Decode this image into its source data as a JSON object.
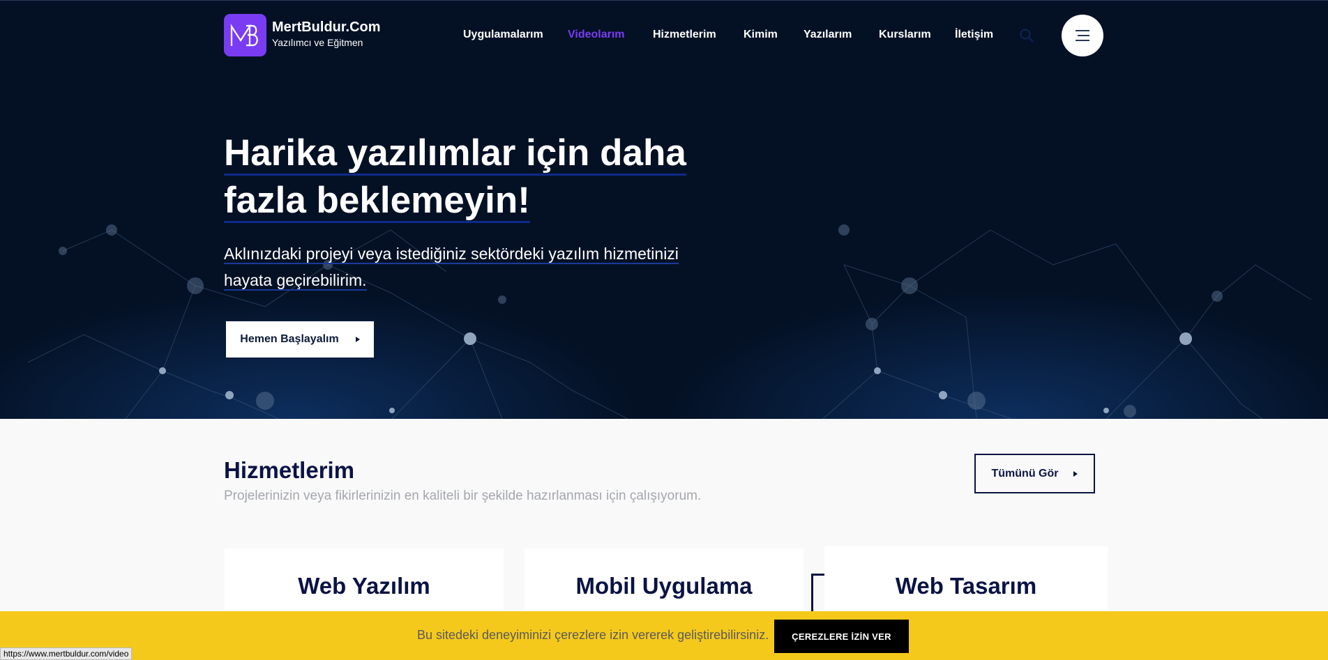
{
  "header": {
    "logo_initials": "MB",
    "site_name": "MertBuldur.Com",
    "site_tagline": "Yazılımcı ve Eğitmen",
    "nav": [
      {
        "label": "Uygulamalarım",
        "active": false
      },
      {
        "label": "Videolarım",
        "active": true
      },
      {
        "label": "Hizmetlerim",
        "active": false
      },
      {
        "label": "Kimim",
        "active": false
      },
      {
        "label": "Yazılarım",
        "active": false
      },
      {
        "label": "Kurslarım",
        "active": false
      },
      {
        "label": "İletişim",
        "active": false
      }
    ],
    "search_icon": "search-icon",
    "menu_icon": "hamburger-menu-icon"
  },
  "hero": {
    "title_line1": "Harika yazılımlar için daha",
    "title_line2": "fazla beklemeyin!",
    "subtitle_line1": "Aklınızdaki projeyi veya istediğiniz sektördeki yazılım hizmetinizi",
    "subtitle_line2": "hayata geçirebilirim.",
    "cta_label": "Hemen Başlayalım"
  },
  "services": {
    "title": "Hizmetlerim",
    "description": "Projelerinizin veya fikirlerinizin en kaliteli bir şekilde hazırlanması için çalışıyorum.",
    "see_all_label": "Tümünü Gör",
    "cards": [
      {
        "title": "Web Yazılım"
      },
      {
        "title": "Mobil Uygulama"
      },
      {
        "title": "Web Tasarım"
      }
    ]
  },
  "cookie": {
    "text": "Bu sitedeki deneyiminizi çerezlere izin vererek geliştirebilirsiniz.",
    "accept_label": "ÇEREZLERE İZİN VER"
  },
  "status_bar": {
    "url": "https://www.mertbuldur.com/video"
  },
  "colors": {
    "hero_bg": "#041125",
    "accent": "#7a3cf3",
    "navy": "#0a1344",
    "cookie_bg": "#f5c91c"
  }
}
